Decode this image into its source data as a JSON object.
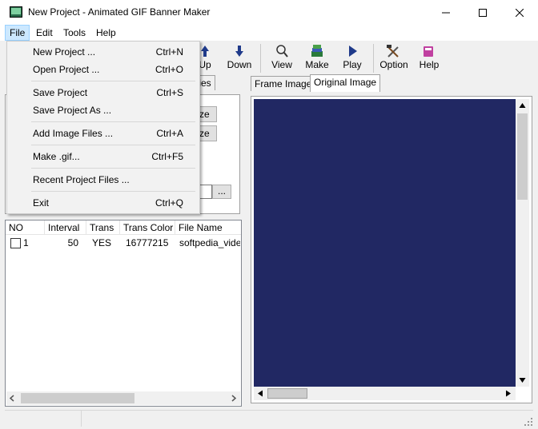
{
  "window": {
    "title": "New Project - Animated GIF Banner Maker",
    "controls": {
      "minimize": "—",
      "maximize": "☐",
      "close": "✕"
    }
  },
  "menubar": {
    "file": "File",
    "edit": "Edit",
    "tools": "Tools",
    "help": "Help"
  },
  "toolbar": {
    "up": "Up",
    "down": "Down",
    "view": "View",
    "make": "Make",
    "play": "Play",
    "option": "Option",
    "help": "Help"
  },
  "left_panel": {
    "tab_partial": "ties",
    "size_button_1": "ize",
    "size_button_2": "ize",
    "browse_button": "..."
  },
  "file_menu": {
    "items": [
      {
        "label": "New Project ...",
        "shortcut": "Ctrl+N"
      },
      {
        "label": "Open Project ...",
        "shortcut": "Ctrl+O"
      },
      {
        "label": "Save Project",
        "shortcut": "Ctrl+S"
      },
      {
        "label": "Save Project As ...",
        "shortcut": ""
      },
      {
        "label": "Add Image Files ...",
        "shortcut": "Ctrl+A"
      },
      {
        "label": "Make .gif...",
        "shortcut": "Ctrl+F5"
      },
      {
        "label": "Recent Project Files ...",
        "shortcut": ""
      },
      {
        "label": "Exit",
        "shortcut": "Ctrl+Q"
      }
    ]
  },
  "frames_list": {
    "columns": [
      "NO",
      "Interval",
      "Trans",
      "Trans Color",
      "File Name"
    ],
    "rows": [
      {
        "no": "1",
        "interval": "50",
        "trans": "YES",
        "trans_color": "16777215",
        "file_name": "softpedia_video"
      }
    ]
  },
  "image_panel": {
    "tabs": [
      "Frame Image",
      "Original Image"
    ],
    "selected_tab": "Original Image",
    "canvas_color": "#212863"
  }
}
